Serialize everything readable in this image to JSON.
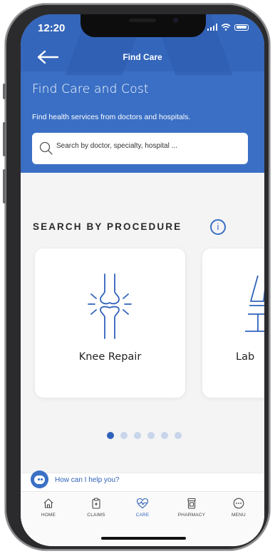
{
  "status": {
    "time": "12:20"
  },
  "nav": {
    "title": "Find Care"
  },
  "page": {
    "title": "Find Care and Cost",
    "subtitle": "Find health services from doctors and hospitals."
  },
  "search": {
    "placeholder": "Search by doctor, specialty, hospital ..."
  },
  "section": {
    "title": "SEARCH BY PROCEDURE",
    "info_glyph": "i"
  },
  "procedures": [
    {
      "label": "Knee Repair",
      "icon": "knee-joint-icon"
    },
    {
      "label": "Lab",
      "icon": "microscope-icon"
    }
  ],
  "carousel": {
    "page_count": 6,
    "active_index": 0
  },
  "chat": {
    "prompt": "How can I help you?"
  },
  "tabs": [
    {
      "label": "HOME",
      "icon": "home-icon",
      "active": false
    },
    {
      "label": "CLAIMS",
      "icon": "clipboard-icon",
      "active": false
    },
    {
      "label": "CARE",
      "icon": "heart-pulse-icon",
      "active": true
    },
    {
      "label": "PHARMACY",
      "icon": "pharmacy-icon",
      "active": false
    },
    {
      "label": "MENU",
      "icon": "more-icon",
      "active": false
    }
  ],
  "colors": {
    "brand": "#3a6fc5",
    "active": "#2f62bb"
  }
}
